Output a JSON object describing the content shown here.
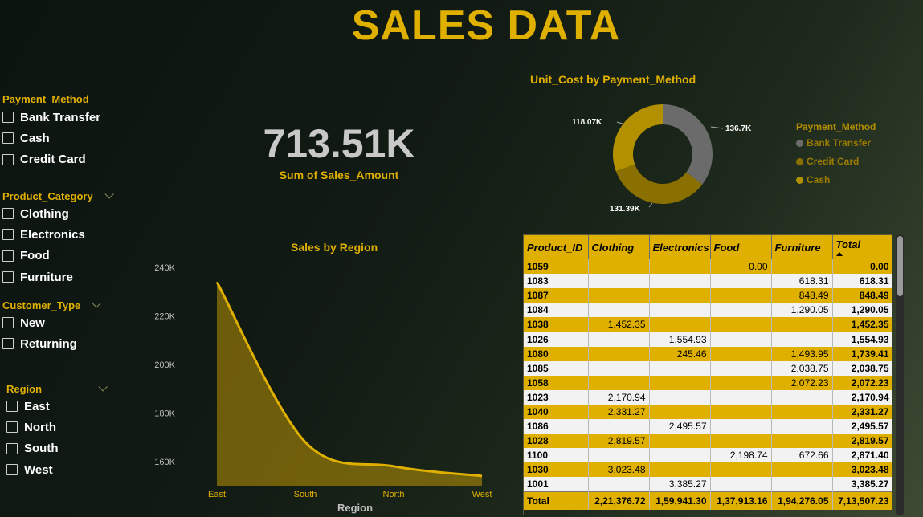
{
  "title": "SALES DATA",
  "slicers": {
    "payment": {
      "title": "Payment_Method",
      "options": [
        "Bank Transfer",
        "Cash",
        "Credit Card"
      ]
    },
    "category": {
      "title": "Product_Category",
      "options": [
        "Clothing",
        "Electronics",
        "Food",
        "Furniture"
      ]
    },
    "customer": {
      "title": "Customer_Type",
      "options": [
        "New",
        "Returning"
      ]
    },
    "region": {
      "title": "Region",
      "options": [
        "East",
        "North",
        "South",
        "West"
      ]
    }
  },
  "kpi": {
    "value": "713.51K",
    "label": "Sum of Sales_Amount"
  },
  "donut": {
    "title": "Unit_Cost by Payment_Method",
    "legend_title": "Payment_Method",
    "data_labels": [
      "136.7K",
      "131.39K",
      "118.07K"
    ]
  },
  "area": {
    "title": "Sales by Region",
    "xlabel": "Region",
    "yticks": [
      "240K",
      "220K",
      "200K",
      "180K",
      "160K"
    ],
    "xticks": [
      "East",
      "South",
      "North",
      "West"
    ]
  },
  "chart_data": [
    {
      "type": "pie",
      "title": "Unit_Cost by Payment_Method",
      "legend_position": "right",
      "categories": [
        "Bank Transfer",
        "Credit Card",
        "Cash"
      ],
      "values": [
        136.7,
        131.39,
        118.07
      ],
      "value_unit": "K",
      "colors": [
        "#6b6b6b",
        "#8a7000",
        "#b39000"
      ]
    },
    {
      "type": "area",
      "title": "Sales by Region",
      "xlabel": "Region",
      "ylabel": "",
      "categories": [
        "East",
        "South",
        "North",
        "West"
      ],
      "values": [
        234,
        168,
        158,
        154
      ],
      "value_unit": "K",
      "ylim": [
        150,
        245
      ],
      "color": "#e0b000"
    }
  ],
  "table": {
    "columns": [
      "Product_ID",
      "Clothing",
      "Electronics",
      "Food",
      "Furniture",
      "Total"
    ],
    "rows": [
      [
        "1059",
        "",
        "",
        "0.00",
        "",
        "0.00"
      ],
      [
        "1083",
        "",
        "",
        "",
        "618.31",
        "618.31"
      ],
      [
        "1087",
        "",
        "",
        "",
        "848.49",
        "848.49"
      ],
      [
        "1084",
        "",
        "",
        "",
        "1,290.05",
        "1,290.05"
      ],
      [
        "1038",
        "1,452.35",
        "",
        "",
        "",
        "1,452.35"
      ],
      [
        "1026",
        "",
        "1,554.93",
        "",
        "",
        "1,554.93"
      ],
      [
        "1080",
        "",
        "245.46",
        "",
        "1,493.95",
        "1,739.41"
      ],
      [
        "1085",
        "",
        "",
        "",
        "2,038.75",
        "2,038.75"
      ],
      [
        "1058",
        "",
        "",
        "",
        "2,072.23",
        "2,072.23"
      ],
      [
        "1023",
        "2,170.94",
        "",
        "",
        "",
        "2,170.94"
      ],
      [
        "1040",
        "2,331.27",
        "",
        "",
        "",
        "2,331.27"
      ],
      [
        "1086",
        "",
        "2,495.57",
        "",
        "",
        "2,495.57"
      ],
      [
        "1028",
        "2,819.57",
        "",
        "",
        "",
        "2,819.57"
      ],
      [
        "1100",
        "",
        "",
        "2,198.74",
        "672.66",
        "2,871.40"
      ],
      [
        "1030",
        "3,023.48",
        "",
        "",
        "",
        "3,023.48"
      ],
      [
        "1001",
        "",
        "3,385.27",
        "",
        "",
        "3,385.27"
      ]
    ],
    "footer": [
      "Total",
      "2,21,376.72",
      "1,59,941.30",
      "1,37,913.16",
      "1,94,276.05",
      "7,13,507.23"
    ]
  },
  "colors": {
    "accent": "#e0b000",
    "bank_transfer": "#6b6b6b",
    "credit_card": "#8a7000",
    "cash": "#b39000"
  }
}
